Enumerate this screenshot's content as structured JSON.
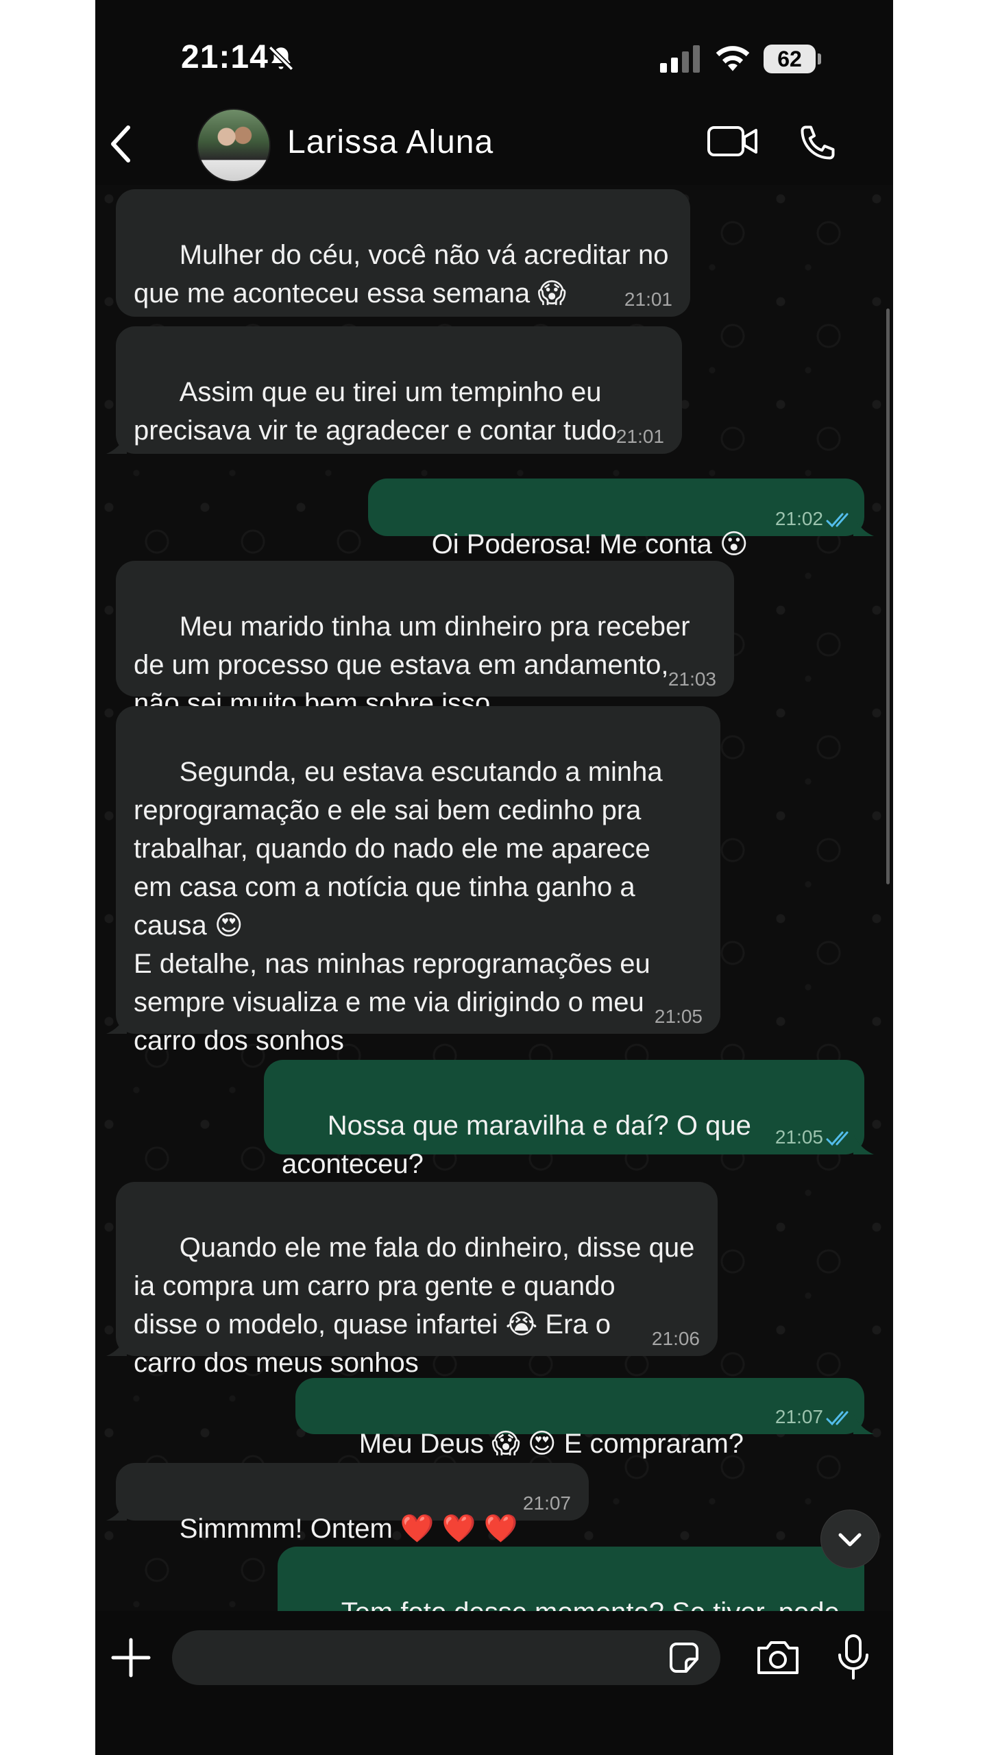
{
  "status_bar": {
    "time": "21:14",
    "battery": "62"
  },
  "header": {
    "contact_name": "Larissa Aluna"
  },
  "messages": [
    {
      "dir": "in",
      "text": "Mulher do céu, você não vá acreditar no\nque me aconteceu essa semana 😱",
      "time": "21:01"
    },
    {
      "dir": "in",
      "text": "Assim que eu tirei um tempinho eu\nprecisava vir te agradecer e contar tudo",
      "time": "21:01"
    },
    {
      "dir": "out",
      "text": "Oi Poderosa! Me conta 😮",
      "time": "21:02",
      "read": true
    },
    {
      "dir": "in",
      "text": "Meu marido tinha um dinheiro pra receber\nde um processo que estava em andamento,\nnão sei muito bem sobre isso",
      "time": "21:03"
    },
    {
      "dir": "in",
      "text": "Segunda, eu estava escutando a minha\nreprogramação e ele sai bem cedinho pra\ntrabalhar, quando do nado ele me aparece\nem casa com a notícia que tinha ganho a\ncausa 😍\nE detalhe, nas minhas reprogramações eu\nsempre visualiza e me via dirigindo o meu\ncarro dos sonhos",
      "time": "21:05"
    },
    {
      "dir": "out",
      "text": "Nossa que maravilha e daí? O que\naconteceu?",
      "time": "21:05",
      "read": true
    },
    {
      "dir": "in",
      "text": "Quando ele me fala do dinheiro, disse que\nia compra um carro pra gente e quando\ndisse o modelo, quase infartei 😭 Era o\ncarro dos meus sonhos",
      "time": "21:06"
    },
    {
      "dir": "out",
      "text": "Meu Deus 😱 😍 E compraram?",
      "time": "21:07",
      "read": true
    },
    {
      "dir": "in",
      "text": "Simmmm! Ontem ❤️ ❤️ ❤️",
      "time": "21:07"
    },
    {
      "dir": "out",
      "text": "Tem foto desse momento? Se tiver, pode\nme enviar?",
      "time": ""
    }
  ],
  "icons": {
    "back": "chevron-left-icon",
    "video": "video-camera-icon",
    "call": "phone-icon",
    "muted": "bell-slash-icon",
    "attach": "plus-icon",
    "sticker": "sticker-icon",
    "camera": "camera-icon",
    "mic": "microphone-icon",
    "scroll_down": "chevron-down-icon"
  },
  "colors": {
    "background": "#0b0b0b",
    "incoming_bubble": "#242626",
    "outgoing_bubble": "#144d37",
    "read_ticks": "#53bdeb"
  }
}
